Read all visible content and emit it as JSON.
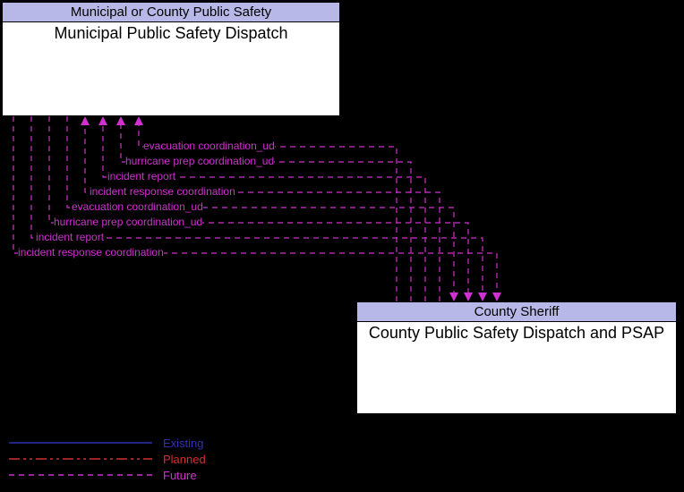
{
  "boxes": {
    "municipal": {
      "header": "Municipal or County Public Safety",
      "title": "Municipal Public Safety Dispatch"
    },
    "county": {
      "header": "County Sheriff",
      "title": "County Public Safety Dispatch and PSAP"
    }
  },
  "flows": [
    {
      "label": "evacuation coordination_ud"
    },
    {
      "label": "hurricane prep coordination_ud"
    },
    {
      "label": "incident report"
    },
    {
      "label": "incident response coordination"
    },
    {
      "label": "evacuation coordination_ud"
    },
    {
      "label": "hurricane prep coordination_ud"
    },
    {
      "label": "incident report"
    },
    {
      "label": "incident response coordination"
    }
  ],
  "legend": {
    "existing": "Existing",
    "planned": "Planned",
    "future": "Future"
  }
}
